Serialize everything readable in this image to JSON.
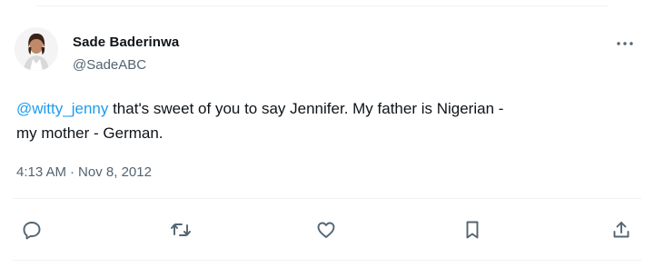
{
  "tweet": {
    "author": {
      "display_name": "Sade Baderinwa",
      "handle": "@SadeABC",
      "avatar_icon": "profile-photo"
    },
    "text": {
      "mention": "@witty_jenny",
      "line1_rest": " that's sweet of you to say Jennifer. My father is Nigerian  -",
      "line2": "my mother - German."
    },
    "time": "4:13 AM",
    "separator": "·",
    "date": "Nov 8, 2012",
    "more_icon": "more-horizontal-icon"
  },
  "actions": [
    {
      "name": "reply",
      "icon": "speech-bubble-icon"
    },
    {
      "name": "retweet",
      "icon": "retweet-icon"
    },
    {
      "name": "like",
      "icon": "heart-icon"
    },
    {
      "name": "bookmark",
      "icon": "bookmark-icon"
    },
    {
      "name": "share",
      "icon": "share-icon"
    }
  ],
  "colors": {
    "text_primary": "#0f1419",
    "text_secondary": "#536471",
    "link": "#1d9bf0",
    "divider": "#eff3f4"
  }
}
